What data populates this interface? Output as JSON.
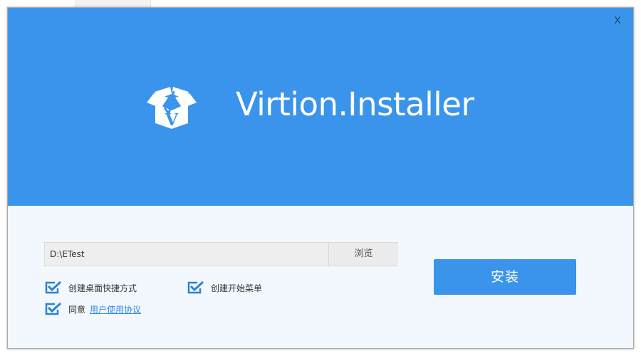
{
  "window": {
    "close_label": "X"
  },
  "header": {
    "title": "Virtion.Installer",
    "logo_letter": "V",
    "background_color": "#3a94eb"
  },
  "install_path": {
    "value": "D:\\ETest",
    "browse_label": "浏览"
  },
  "install_button": {
    "label": "安装"
  },
  "options": {
    "desktop_shortcut": {
      "label": "创建桌面快捷方式",
      "checked": true
    },
    "start_menu": {
      "label": "创建开始菜单",
      "checked": true
    },
    "agree": {
      "label": "同意",
      "link_text": "用户使用协议",
      "checked": true
    }
  },
  "colors": {
    "accent": "#3a94eb",
    "body_background": "#f2f8fd",
    "link": "#2f8ce6",
    "checkbox": "#2b82d9"
  }
}
